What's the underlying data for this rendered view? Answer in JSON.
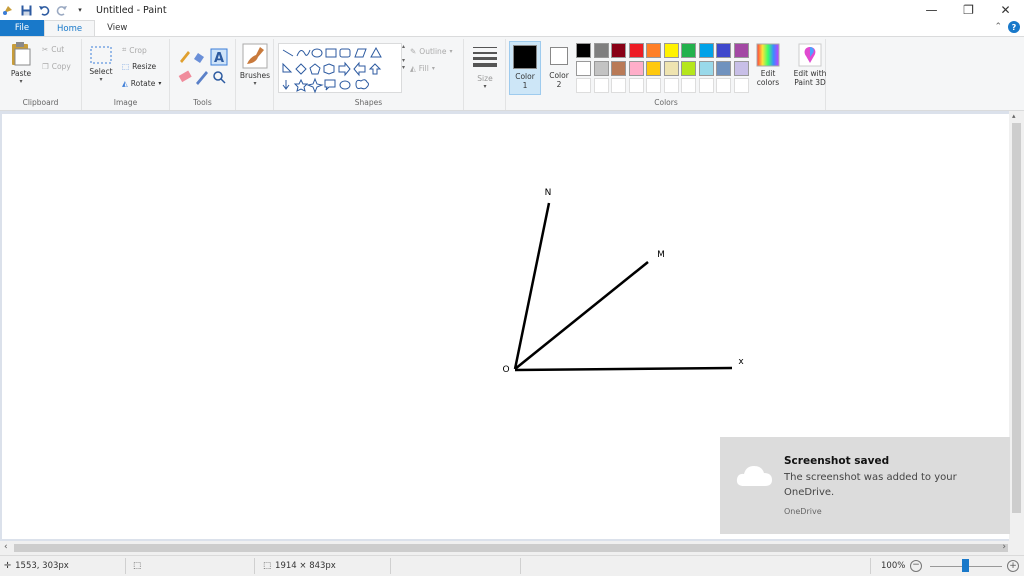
{
  "window": {
    "title": "Untitled - Paint",
    "controls": {
      "minimize": "—",
      "maximize": "❐",
      "close": "✕"
    }
  },
  "tabs": {
    "file": "File",
    "home": "Home",
    "view": "View"
  },
  "ribbon": {
    "clipboard": {
      "label": "Clipboard",
      "paste": "Paste",
      "cut": "Cut",
      "copy": "Copy"
    },
    "image": {
      "label": "Image",
      "select": "Select",
      "crop": "Crop",
      "resize": "Resize",
      "rotate": "Rotate"
    },
    "tools": {
      "label": "Tools"
    },
    "brushes": {
      "label": "Brushes"
    },
    "shapes": {
      "label": "Shapes",
      "outline": "Outline",
      "fill": "Fill"
    },
    "size": {
      "label": "Size"
    },
    "colors": {
      "label": "Colors",
      "color1": "Color",
      "color1_num": "1",
      "color2": "Color",
      "color2_num": "2",
      "edit_colors_line1": "Edit",
      "edit_colors_line2": "colors",
      "paint3d_line1": "Edit with",
      "paint3d_line2": "Paint 3D",
      "color1_value": "#000000",
      "color2_value": "#ffffff",
      "row1": [
        "#000000",
        "#7f7f7f",
        "#880015",
        "#ed1c24",
        "#ff7f27",
        "#fff200",
        "#22b14c",
        "#00a2e8",
        "#3f48cc",
        "#a349a4"
      ],
      "row2": [
        "#ffffff",
        "#c3c3c3",
        "#b97a57",
        "#ffaec9",
        "#ffc90e",
        "#efe4b0",
        "#b5e61d",
        "#99d9ea",
        "#7092be",
        "#c8bfe7"
      ]
    }
  },
  "drawing": {
    "labels": {
      "n": "N",
      "m": "M",
      "o": "O",
      "x": "x"
    }
  },
  "toast": {
    "title": "Screenshot saved",
    "body": "The screenshot was added to your OneDrive.",
    "source": "OneDrive"
  },
  "status": {
    "cursor": "1553, 303px",
    "canvas_size": "1914 × 843px",
    "zoom": "100%"
  }
}
